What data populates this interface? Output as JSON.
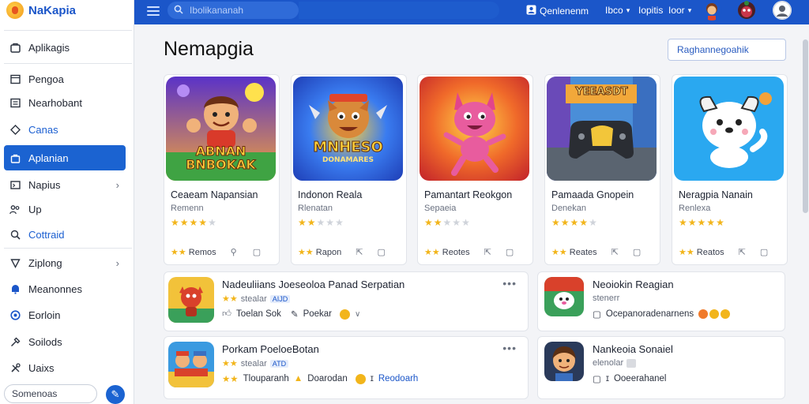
{
  "brand": {
    "name": "NaKapia"
  },
  "sidebar": {
    "items": [
      {
        "label": "Aplikagis",
        "icon": "apps-icon"
      },
      {
        "label": "Pengoa",
        "icon": "window-icon"
      },
      {
        "label": "Nearhobant",
        "icon": "list-icon"
      },
      {
        "label": "Canas",
        "icon": "diamond-icon"
      },
      {
        "label": "Aplanian",
        "icon": "bag-icon"
      },
      {
        "label": "Napius",
        "icon": "card-icon"
      },
      {
        "label": "Up",
        "icon": "people-icon"
      },
      {
        "label": "Cottraid",
        "icon": "search-user-icon"
      },
      {
        "label": "Ziplong",
        "icon": "shield-icon"
      },
      {
        "label": "Meanonnes",
        "icon": "bell-icon"
      },
      {
        "label": "Eorloin",
        "icon": "globe-icon"
      },
      {
        "label": "Soilods",
        "icon": "pin-icon"
      },
      {
        "label": "Uaixs",
        "icon": "tools-icon"
      }
    ],
    "bottom_label": "Somenoas"
  },
  "topbar": {
    "search_placeholder": "Ibolikananah",
    "account_label": "Qenlenenm",
    "link_1": "Ibco",
    "link_2": "Iopitis",
    "link_3": "Ioor"
  },
  "main": {
    "title": "Nemapgia",
    "action_label": "Raghannegoahik"
  },
  "featured": [
    {
      "art_title_1": "ABNAN",
      "art_title_2": "BNBOKAK",
      "title": "Ceaeam Napansian",
      "subtitle": "Remenn",
      "rating": 4,
      "foot_label": "Remos"
    },
    {
      "art_title_1": "MNHESO",
      "art_title_2": "DONAMARES",
      "title": "Indonon Reala",
      "subtitle": "Rlenatan",
      "rating": 2,
      "foot_label": "Rapon"
    },
    {
      "art_title_1": "",
      "art_title_2": "",
      "title": "Pamantart Reokgon",
      "subtitle": "Sepaeia",
      "rating": 2,
      "foot_label": "Reotes"
    },
    {
      "art_title_1": "YEEASDT",
      "art_title_2": "",
      "title": "Pamaada Gnopein",
      "subtitle": "Denekan",
      "rating": 4,
      "foot_label": "Reates"
    },
    {
      "art_title_1": "",
      "art_title_2": "",
      "title": "Neragpia Nanain",
      "subtitle": "Renlexa",
      "rating": 5,
      "foot_label": "Reatos"
    }
  ],
  "rows": [
    {
      "title": "Nadeuliians Joeseoloa Panad Serpatian",
      "meta": "stealar",
      "tag": "AIJD",
      "line_1": "Toelan Sok",
      "line_2": "Poekar"
    },
    {
      "title": "Neoiokin Reagian",
      "meta": "stenerr",
      "tag": "",
      "line_1": "Ocepanoradenarnens",
      "line_2": ""
    },
    {
      "title": "Porkam PoeloeBotan",
      "meta": "stealar",
      "tag": "ATD",
      "line_1": "Tlouparanh",
      "line_2": "Doarodan",
      "line_3": "Reodoarh"
    },
    {
      "title": "Nankeoia Sonaiel",
      "meta": "elenolar",
      "tag": "",
      "line_1": "Ooeerahanel",
      "line_2": ""
    }
  ],
  "colors": {
    "primary": "#1b56c9",
    "active": "#1b63d1",
    "star": "#f2b51b"
  }
}
